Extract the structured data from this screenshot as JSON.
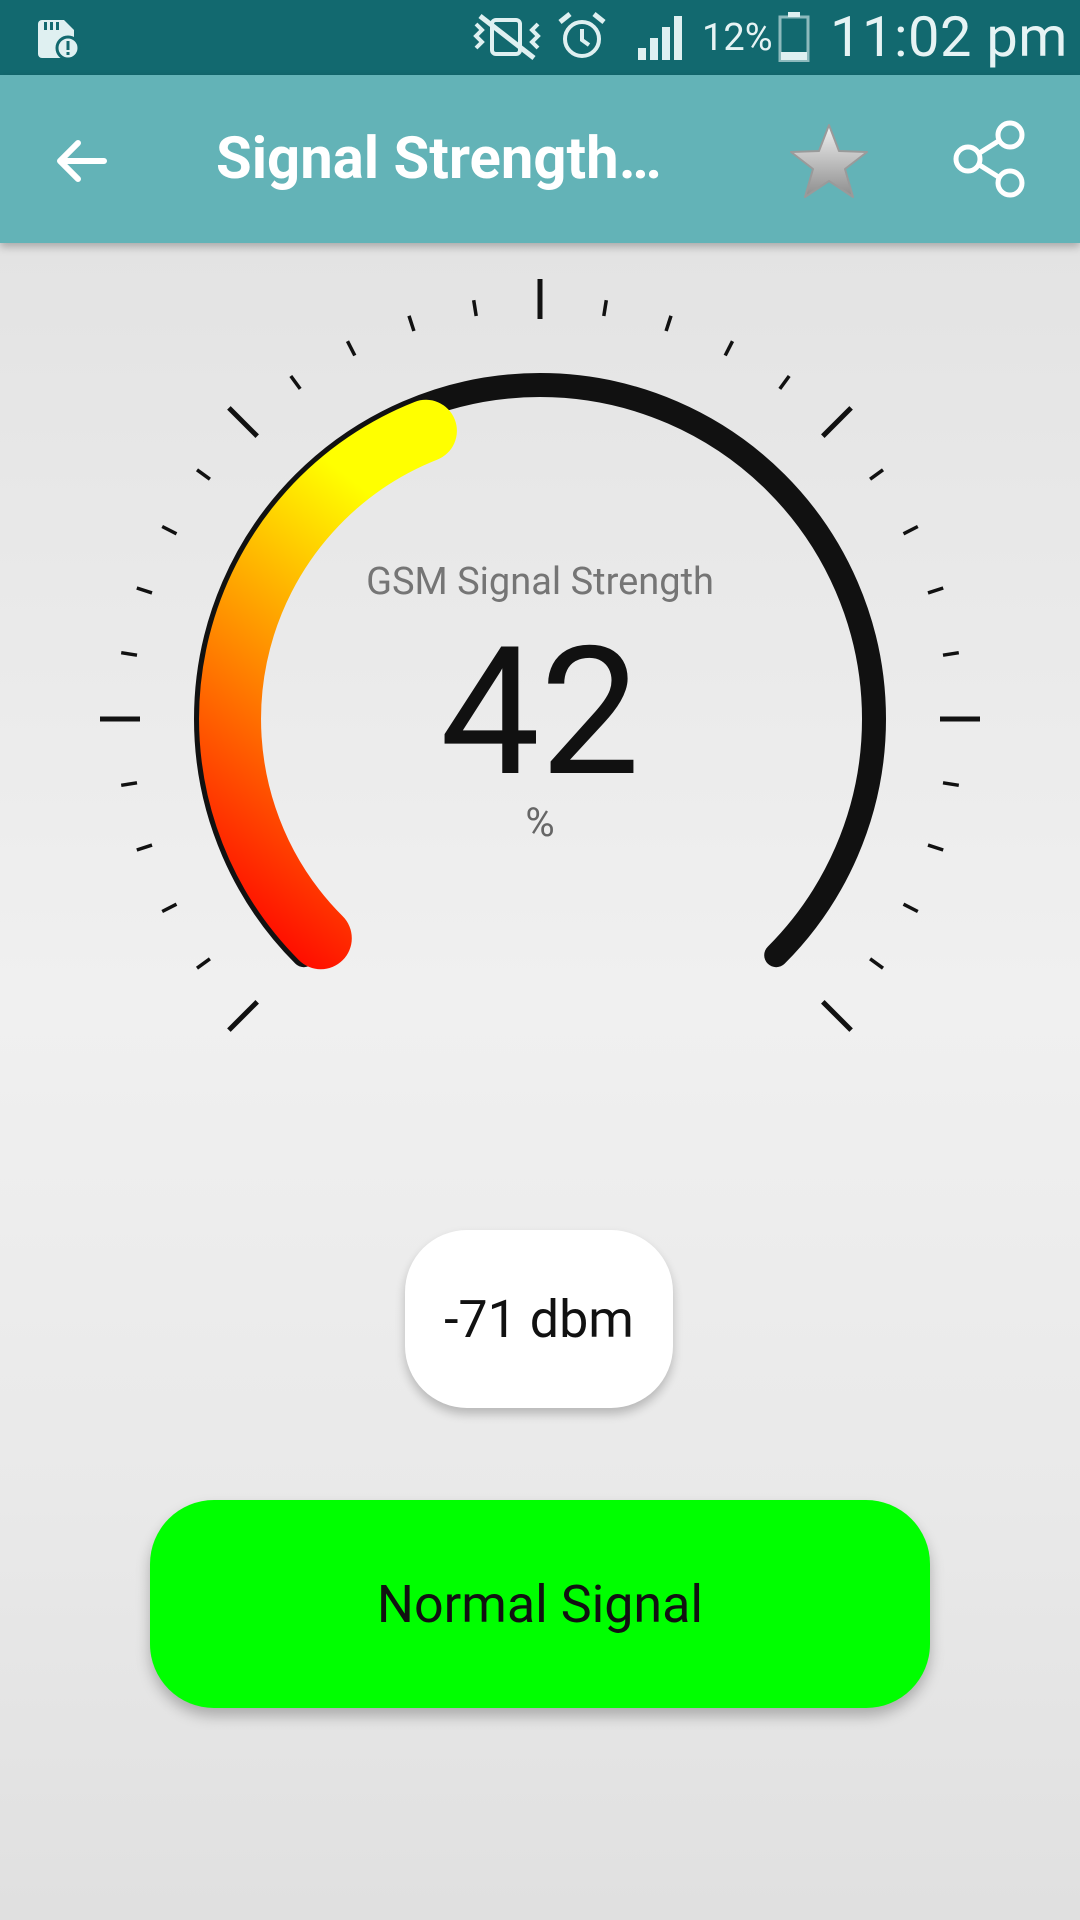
{
  "status_bar": {
    "battery_percent": "12%",
    "time": "11:02 pm",
    "icons": [
      "sd-card-alert-icon",
      "vibrate-mute-icon",
      "alarm-icon",
      "cell-signal-icon",
      "battery-icon"
    ]
  },
  "app_bar": {
    "title": "Signal Strength…",
    "icons": [
      "back-arrow-icon",
      "star-icon",
      "share-icon"
    ]
  },
  "gauge": {
    "label": "GSM Signal Strength",
    "value": "42",
    "unit": "%",
    "level_fraction": 0.42
  },
  "dbm": "-71 dbm",
  "status": {
    "label": "Normal Signal",
    "color": "#00ff00"
  },
  "colors": {
    "status_bar_bg": "#12696f",
    "app_bar_bg": "#63b3b7",
    "gauge_track": "#111111",
    "gauge_fill_start": "#ff0000",
    "gauge_fill_end": "#ffff00"
  }
}
